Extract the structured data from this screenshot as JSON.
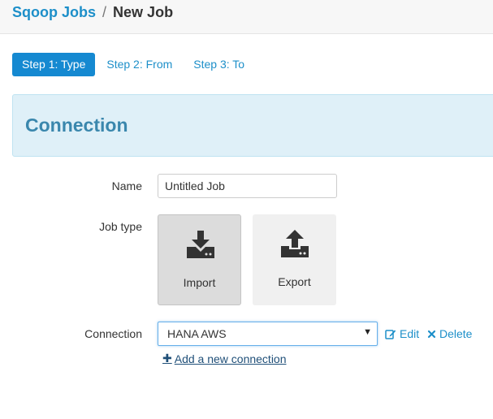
{
  "breadcrumb": {
    "parent": "Sqoop Jobs",
    "separator": "/",
    "current": "New Job"
  },
  "steps": [
    {
      "label": "Step 1: Type",
      "active": true
    },
    {
      "label": "Step 2: From",
      "active": false
    },
    {
      "label": "Step 3: To",
      "active": false
    }
  ],
  "section": {
    "title": "Connection"
  },
  "form": {
    "name_label": "Name",
    "name_value": "Untitled Job",
    "jobtype_label": "Job type",
    "jobtypes": [
      {
        "label": "Import",
        "icon": "import-icon",
        "selected": true
      },
      {
        "label": "Export",
        "icon": "export-icon",
        "selected": false
      }
    ],
    "connection_label": "Connection",
    "connection_value": "HANA AWS",
    "edit_label": "Edit",
    "delete_label": "Delete",
    "add_connection_label": "Add a new connection"
  },
  "colors": {
    "accent": "#1589d1",
    "link": "#1d8fc9",
    "section_bg": "#dff0f8",
    "section_title": "#3a87ad"
  }
}
